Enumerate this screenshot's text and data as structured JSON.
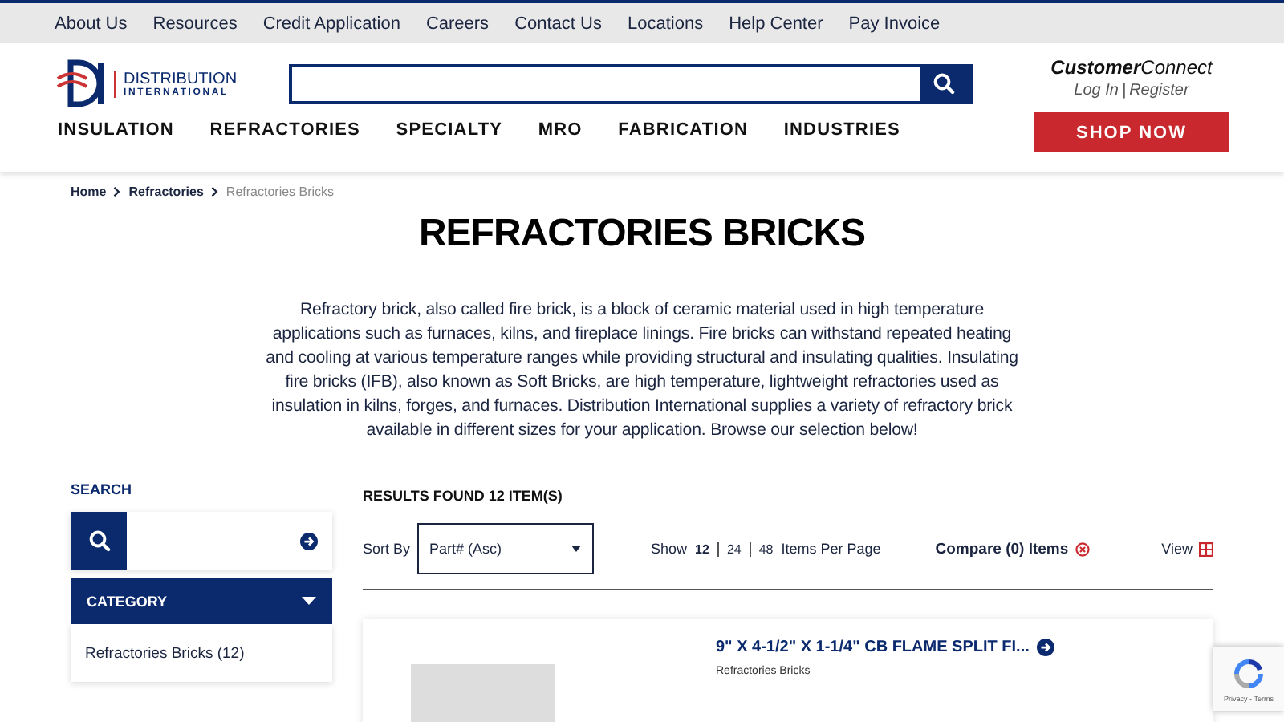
{
  "top_links": [
    "About Us",
    "Resources",
    "Credit Application",
    "Careers",
    "Contact Us",
    "Locations",
    "Help Center",
    "Pay Invoice"
  ],
  "logo": {
    "line1": "DISTRIBUTION",
    "line2": "INTERNATIONAL"
  },
  "customer_connect": {
    "brand_bold": "Customer",
    "brand_rest": "Connect",
    "login": "Log In",
    "separator": "|",
    "register": "Register"
  },
  "nav": [
    "INSULATION",
    "REFRACTORIES",
    "SPECIALTY",
    "MRO",
    "FABRICATION",
    "INDUSTRIES"
  ],
  "shop_button": "SHOP NOW",
  "breadcrumb": [
    {
      "label": "Home",
      "current": false
    },
    {
      "label": "Refractories",
      "current": false
    },
    {
      "label": "Refractories Bricks",
      "current": true
    }
  ],
  "title": "REFRACTORIES BRICKS",
  "description": "Refractory brick, also called fire brick, is a block of ceramic material used in high temperature applications such as furnaces, kilns, and fireplace linings. Fire bricks can withstand repeated heating and cooling at various temperature ranges while providing structural and insulating qualities. Insulating fire bricks (IFB), also known as Soft Bricks, are high temperature, lightweight refractories used as insulation in kilns, forges, and furnaces. Distribution International supplies a variety of refractory brick available in different sizes for your application. Browse our selection below!",
  "sidebar": {
    "search_label": "SEARCH",
    "category_label": "CATEGORY",
    "category_expanded": true,
    "categories": [
      "Refractories Bricks (12)"
    ]
  },
  "results": {
    "count_text": "RESULTS FOUND 12 ITEM(S)",
    "sort_label": "Sort By",
    "sort_value": "Part# (Asc)",
    "show_label": "Show",
    "per_page": [
      {
        "label": "12",
        "selected": true
      },
      {
        "label": "24",
        "selected": false
      },
      {
        "label": "48",
        "selected": false
      }
    ],
    "per_page_suffix": "Items Per Page",
    "compare": "Compare (0) Items",
    "view_label": "View"
  },
  "products": [
    {
      "name": "9\" X 4-1/2\" X 1-1/4\" CB FLAME SPLIT FI...",
      "category": "Refractories Bricks"
    }
  ],
  "recaptcha": {
    "links": "Privacy - Terms"
  }
}
